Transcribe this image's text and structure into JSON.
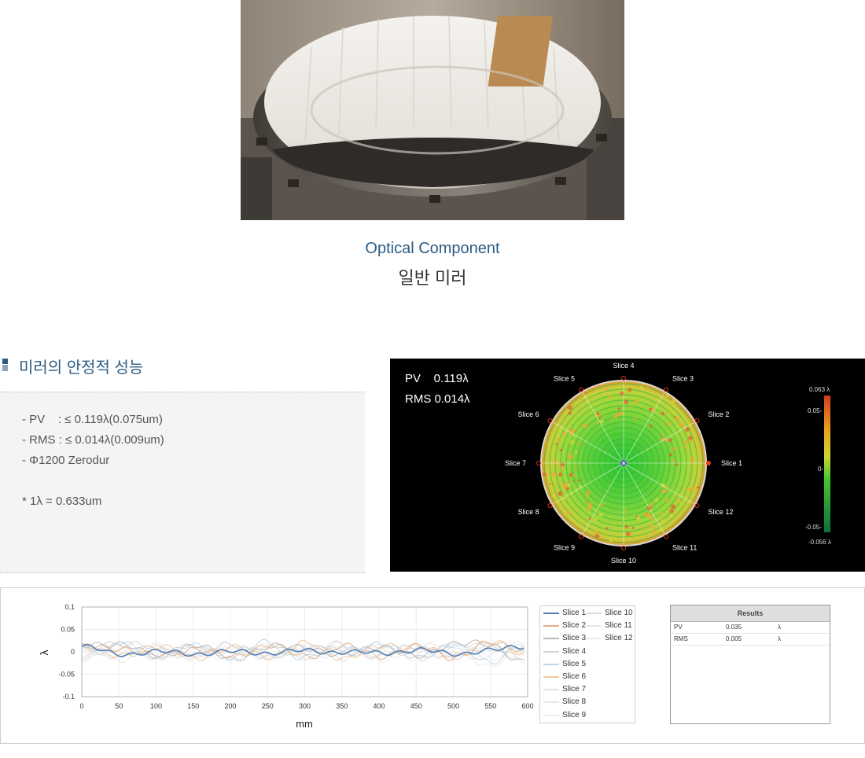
{
  "caption": {
    "english": "Optical Component",
    "korean": "일반 미러"
  },
  "section": {
    "title": "미러의 안정적 성능"
  },
  "specs": [
    "- PV    : ≤ 0.119λ(0.075um)",
    "- RMS : ≤ 0.014λ(0.009um)",
    "- Φ1200 Zerodur",
    "* 1λ = 0.633um"
  ],
  "contour_map": {
    "pv_text": "PV    0.119λ",
    "rms_text": "RMS 0.014λ",
    "slices": [
      "Slice 1",
      "Slice 2",
      "Slice 3",
      "Slice 4",
      "Slice 5",
      "Slice 6",
      "Slice 7",
      "Slice 8",
      "Slice 9",
      "Slice 10",
      "Slice 11",
      "Slice 12"
    ],
    "colorbar": {
      "max_label": "0.063 λ",
      "upper_label": "0.05-",
      "mid_label": "0-",
      "lower_label": "-0.05-",
      "min_label": "-0.056 λ"
    },
    "colors": {
      "high": "#e23a1a",
      "mid": "#1fbf2a",
      "low": "#0b6e3a"
    }
  },
  "legend": [
    {
      "label": "Slice 1",
      "color": "#4f7fb6"
    },
    {
      "label": "Slice 2",
      "color": "#e3b08a"
    },
    {
      "label": "Slice 3",
      "color": "#b9b9b9"
    },
    {
      "label": "Slice 4",
      "color": "#d5d5d5"
    },
    {
      "label": "Slice 5",
      "color": "#bcd5e8"
    },
    {
      "label": "Slice 6",
      "color": "#f3c79a"
    },
    {
      "label": "Slice 7",
      "color": "#e2e2e2"
    },
    {
      "label": "Slice 8",
      "color": "#e8e8e8"
    },
    {
      "label": "Slice 9",
      "color": "#ededed"
    },
    {
      "label": "Slice 10",
      "color": "#dcdcdc"
    },
    {
      "label": "Slice 11",
      "color": "#e5e5e5"
    },
    {
      "label": "Slice 12",
      "color": "#eaeaea"
    }
  ],
  "results": {
    "title": "Results",
    "rows": [
      {
        "name": "PV",
        "value": "0.035",
        "unit": "λ"
      },
      {
        "name": "RMS",
        "value": "0.005",
        "unit": "λ"
      }
    ]
  },
  "chart_data": {
    "type": "line",
    "xlabel": "mm",
    "ylabel": "λ",
    "xlim": [
      0,
      600
    ],
    "ylim": [
      -0.1,
      0.1
    ],
    "x_ticks": [
      0,
      50,
      100,
      150,
      200,
      250,
      300,
      350,
      400,
      450,
      500,
      550,
      600
    ],
    "y_ticks": [
      0.1,
      0.05,
      0,
      -0.05,
      -0.1
    ],
    "x_tick_labels": [
      "0",
      "50",
      "100",
      "150",
      "200",
      "250",
      "300",
      "350",
      "400",
      "450",
      "500",
      "550",
      "600"
    ],
    "y_tick_labels": [
      "0.1",
      "0.05",
      "0",
      "-0.05",
      "-0.1"
    ],
    "grid": true,
    "x": [
      0,
      50,
      100,
      150,
      200,
      250,
      300,
      350,
      400,
      450,
      500,
      550,
      595
    ],
    "series": [
      {
        "name": "Slice 1",
        "values": [
          0.012,
          -0.005,
          0.0,
          -0.004,
          0.0,
          -0.002,
          0.002,
          0.0,
          -0.003,
          0.004,
          -0.004,
          0.003,
          0.012
        ]
      },
      {
        "name": "Slice 2",
        "values": [
          0.01,
          0.01,
          -0.01,
          0.008,
          -0.012,
          0.015,
          -0.01,
          0.012,
          -0.008,
          0.01,
          -0.01,
          0.018,
          0.008
        ]
      },
      {
        "name": "Slice 3",
        "values": [
          0.015,
          0.02,
          -0.012,
          0.015,
          -0.015,
          0.01,
          0.012,
          -0.01,
          0.015,
          -0.012,
          0.02,
          0.015,
          -0.02
        ]
      },
      {
        "name": "Slice 4",
        "values": [
          -0.01,
          0.015,
          0.012,
          -0.008,
          0.02,
          -0.015,
          0.01,
          0.015,
          -0.01,
          0.012,
          -0.015,
          0.01,
          0.005
        ]
      },
      {
        "name": "Slice 5",
        "values": [
          0.008,
          0.018,
          -0.008,
          0.012,
          -0.01,
          0.02,
          -0.012,
          0.008,
          0.015,
          -0.01,
          0.012,
          -0.02,
          0.01
        ]
      },
      {
        "name": "Slice 6",
        "values": [
          0.012,
          -0.012,
          0.015,
          -0.015,
          0.01,
          -0.01,
          0.018,
          -0.012,
          0.01,
          0.015,
          -0.012,
          0.025,
          -0.01
        ]
      },
      {
        "name": "Slice 7",
        "values": [
          -0.012,
          0.01,
          -0.01,
          0.015,
          -0.008,
          0.012,
          -0.015,
          0.01,
          -0.012,
          0.008,
          0.015,
          -0.01,
          0.012
        ]
      },
      {
        "name": "Slice 8",
        "values": [
          0.01,
          -0.015,
          0.012,
          -0.01,
          0.015,
          -0.012,
          0.008,
          -0.015,
          0.012,
          -0.01,
          0.008,
          0.012,
          -0.015
        ]
      },
      {
        "name": "Slice 9",
        "values": [
          -0.008,
          0.012,
          -0.015,
          0.01,
          -0.012,
          0.015,
          -0.01,
          0.012,
          -0.015,
          0.01,
          -0.012,
          -0.015,
          0.01
        ]
      },
      {
        "name": "Slice 10",
        "values": [
          0.015,
          -0.01,
          0.01,
          -0.012,
          0.012,
          -0.015,
          0.015,
          -0.008,
          0.01,
          -0.015,
          0.012,
          0.01,
          -0.012
        ]
      },
      {
        "name": "Slice 11",
        "values": [
          -0.015,
          0.012,
          -0.012,
          0.01,
          -0.015,
          0.01,
          -0.012,
          0.015,
          -0.008,
          0.012,
          -0.01,
          0.012,
          0.015
        ]
      },
      {
        "name": "Slice 12",
        "values": [
          0.01,
          -0.01,
          0.015,
          -0.015,
          0.012,
          -0.008,
          0.01,
          -0.012,
          0.015,
          -0.012,
          0.01,
          -0.03,
          0.008
        ]
      }
    ]
  }
}
